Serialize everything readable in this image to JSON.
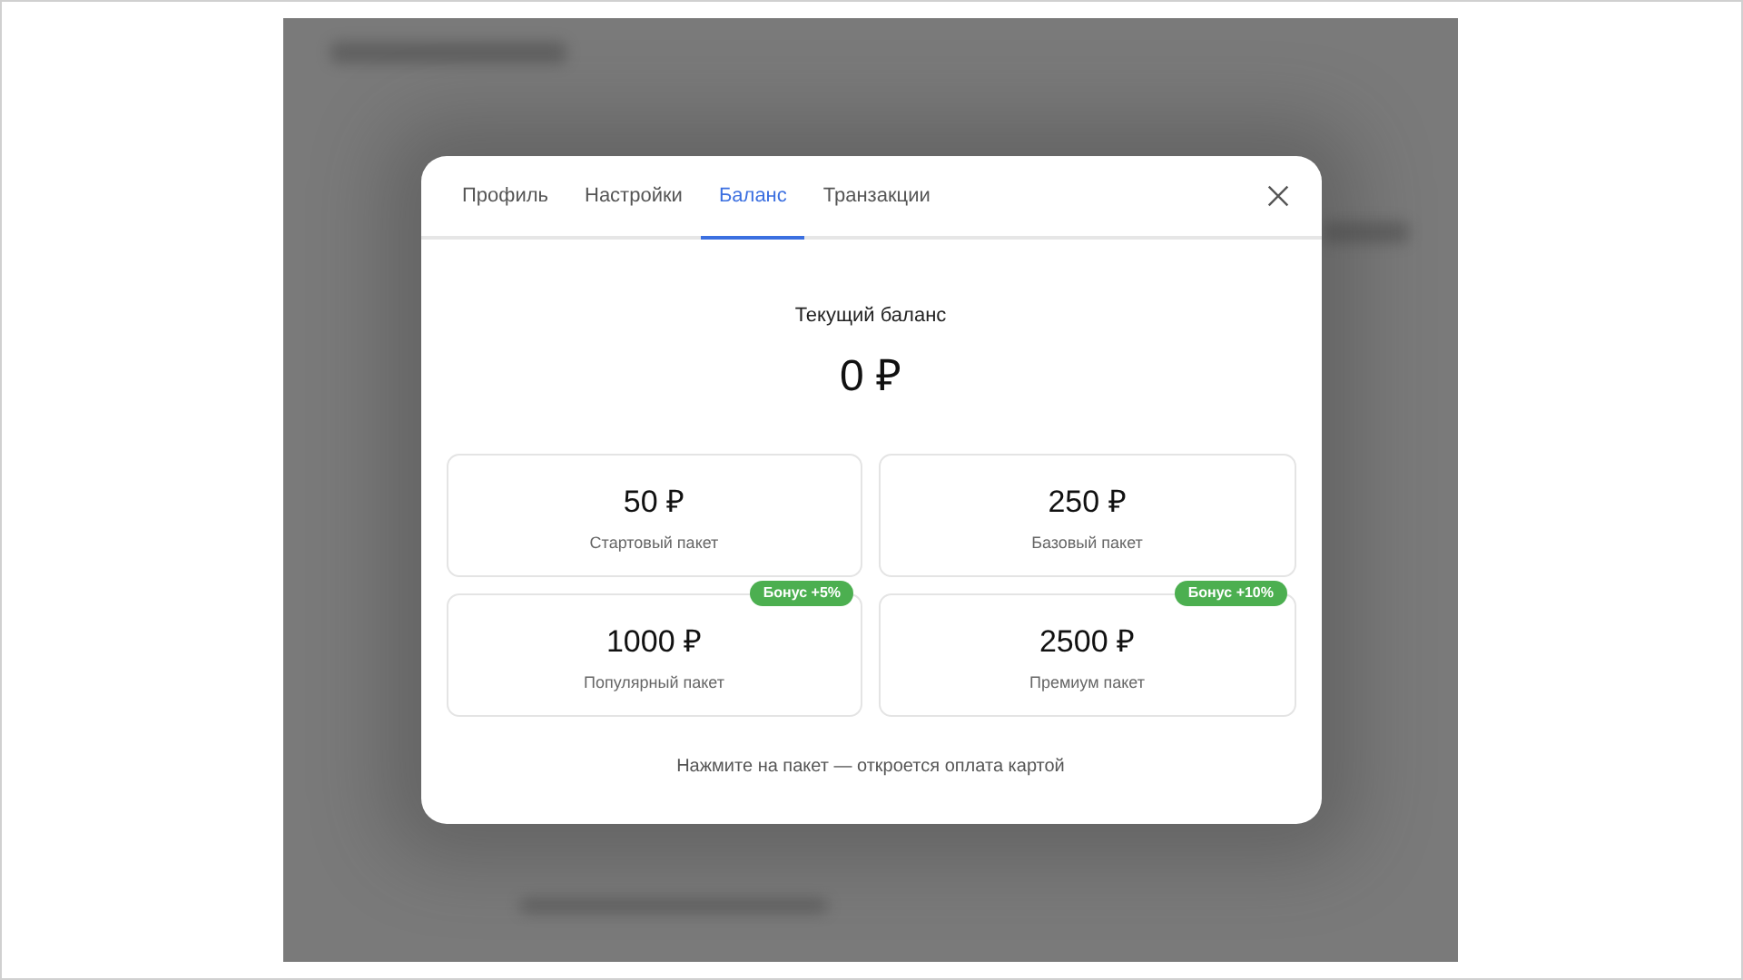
{
  "dialog": {
    "tabs": [
      {
        "label": "Профиль",
        "selected": false
      },
      {
        "label": "Настройки",
        "selected": false
      },
      {
        "label": "Баланс",
        "selected": true
      },
      {
        "label": "Транзакции",
        "selected": false
      }
    ],
    "balance": {
      "label": "Текущий баланс",
      "amount": "0 ₽"
    },
    "packages": [
      {
        "amount": "50 ₽",
        "name": "Стартовый пакет"
      },
      {
        "amount": "250 ₽",
        "name": "Базовый пакет"
      },
      {
        "amount": "1000 ₽",
        "name": "Популярный пакет",
        "badge": "Бонус +5%"
      },
      {
        "amount": "2500 ₽",
        "name": "Премиум пакет",
        "badge": "Бонус +10%"
      }
    ],
    "hint": "Нажмите на пакет — откроется оплата картой"
  }
}
